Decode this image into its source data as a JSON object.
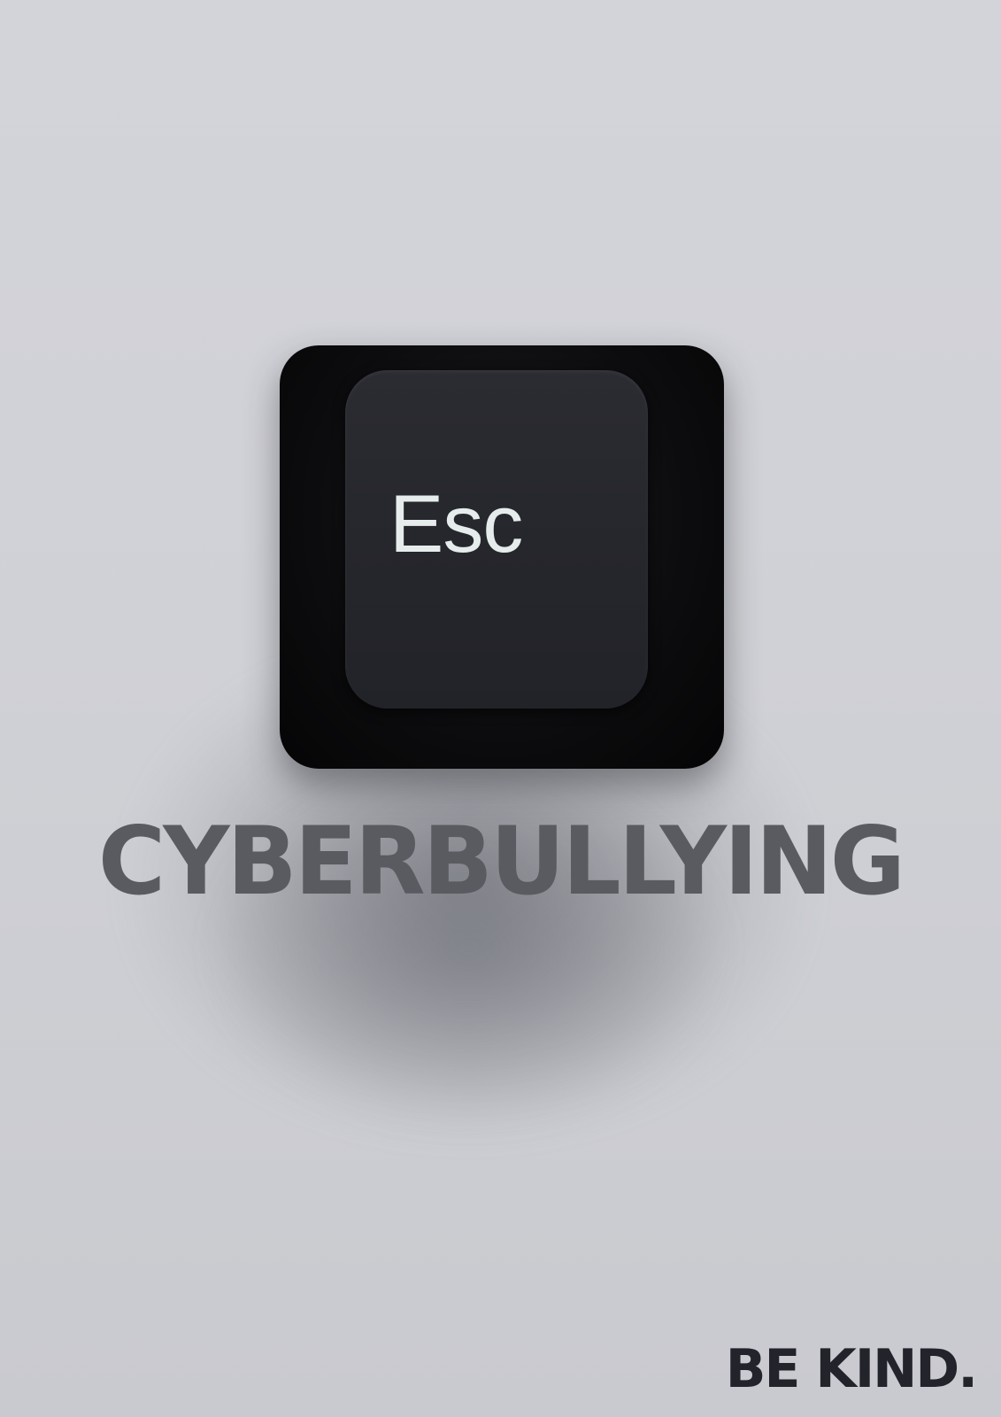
{
  "key": {
    "label": "Esc"
  },
  "headline": "CYBERBULLYING",
  "tagline": "BE KIND.",
  "colors": {
    "background": "#d0d1d6",
    "key": "#0c0c0e",
    "key_top": "#26272d",
    "key_label": "#e6eceb",
    "headline": "#5a5b60",
    "tagline": "#23242b"
  }
}
